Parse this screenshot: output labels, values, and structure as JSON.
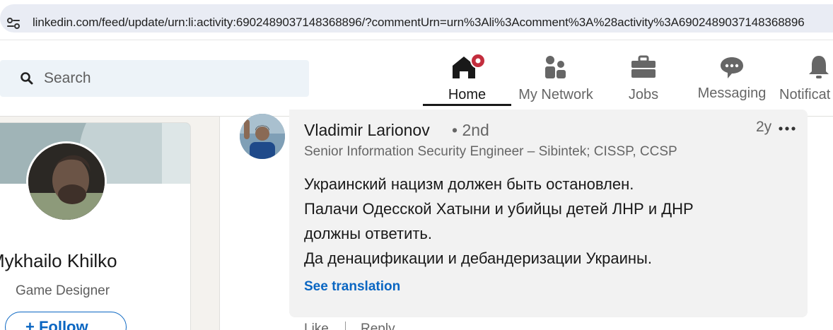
{
  "browser": {
    "url": "linkedin.com/feed/update/urn:li:activity:6902489037148368896/?commentUrn=urn%3Ali%3Acomment%3A%28activity%3A6902489037148368896"
  },
  "search": {
    "placeholder": "Search"
  },
  "nav": {
    "items": [
      {
        "label": "Home",
        "icon": "home-icon"
      },
      {
        "label": "My Network",
        "icon": "people-icon"
      },
      {
        "label": "Jobs",
        "icon": "briefcase-icon"
      },
      {
        "label": "Messaging",
        "icon": "chat-icon"
      },
      {
        "label": "Notificat",
        "icon": "bell-icon"
      }
    ],
    "accent_color": "#c32d3d"
  },
  "profile": {
    "name": "Mykhailo Khilko",
    "headline": "Game Designer",
    "follow_label": "+ Follow"
  },
  "comment": {
    "author": "Vladimir Larionov",
    "degree": "• 2nd",
    "title": "Senior Information Security Engineer – Sibintek; CISSP, CCSP",
    "time": "2y",
    "lines": [
      "Украинский нацизм должен быть остановлен.",
      "Палачи Одесской Хатыни и убийцы детей ЛНР и ДНР",
      "должны ответить.",
      "Да денацификации и дебандеризации Украины."
    ],
    "see_translation": "See translation",
    "like_label": "Like",
    "reply_label": "Reply"
  },
  "colors": {
    "link": "#0a66c2",
    "bubble": "#f2f2f2",
    "page_bg": "#f4f2ee"
  }
}
